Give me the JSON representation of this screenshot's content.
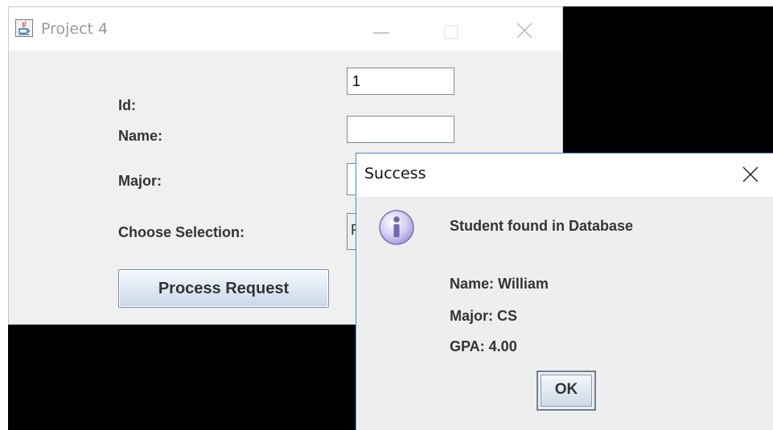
{
  "main_window": {
    "title": "Project 4",
    "fields": {
      "id_label": "Id:",
      "id_value": "1",
      "name_label": "Name:",
      "name_value": "",
      "major_label": "Major:",
      "major_value": "",
      "selection_label": "Choose Selection:",
      "selection_value": "F"
    },
    "process_button_label": "Process Request"
  },
  "dialog": {
    "title": "Success",
    "icon": "info-icon",
    "message": "Student found in Database",
    "details": {
      "name": "Name: William",
      "major": "Major: CS",
      "gpa": "GPA: 4.00"
    },
    "ok_label": "OK"
  },
  "colors": {
    "desktop": "#000000",
    "window_bg": "#f0f0f0",
    "dialog_border": "#3d8fd6",
    "button_border": "#7a8ea8"
  }
}
